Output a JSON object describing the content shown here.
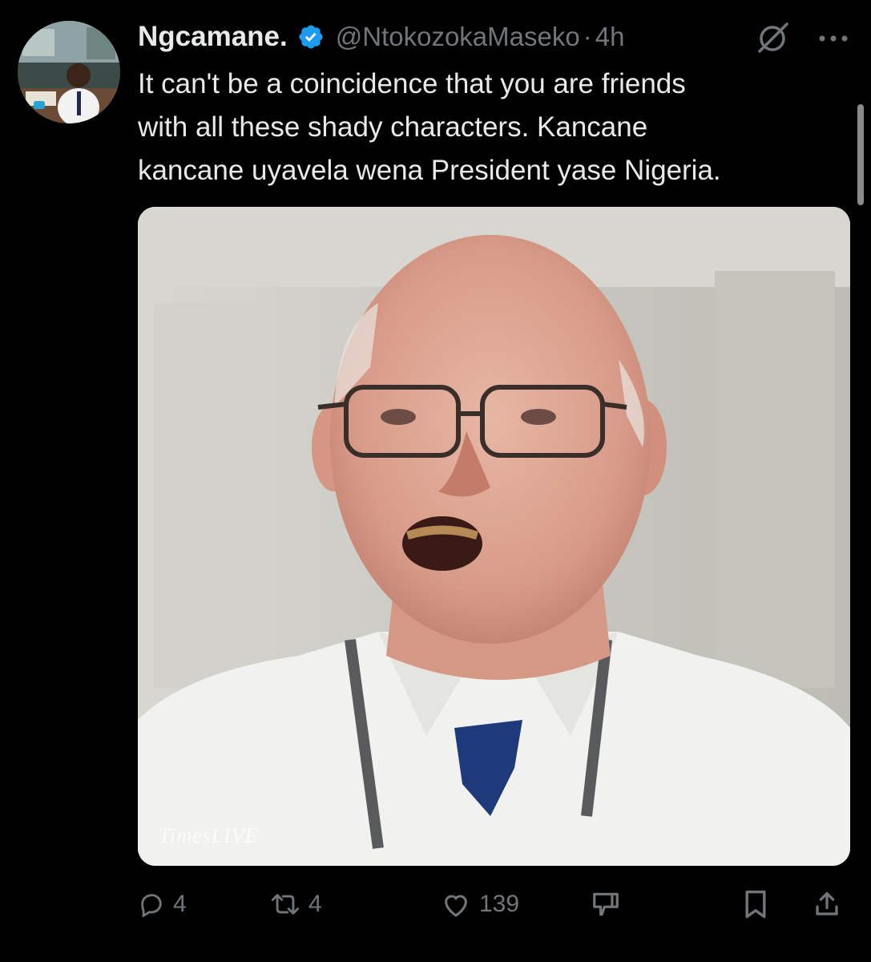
{
  "tweet": {
    "author_name": "Ngcamane.",
    "handle": "@NtokozokaMaseko",
    "separator": "·",
    "time": "4h",
    "text": "It can't be a coincidence that you are friends\nwith all these shady characters. Kancane\nkancane uyavela wena President yase Nigeria.",
    "media": {
      "watermark": "TimesLIVE"
    }
  },
  "actions": {
    "replies": "4",
    "reposts": "4",
    "likes": "139"
  },
  "icons": {
    "verified": "verified-badge-icon",
    "grok": "grok-icon",
    "more": "more-icon",
    "reply": "reply-icon",
    "repost": "repost-icon",
    "like": "heart-icon",
    "dislike": "dislike-icon",
    "bookmark": "bookmark-icon",
    "share": "share-icon"
  },
  "colors": {
    "background": "#000000",
    "text": "#e7e9ea",
    "muted": "#71767b",
    "verified": "#1d9bf0"
  }
}
